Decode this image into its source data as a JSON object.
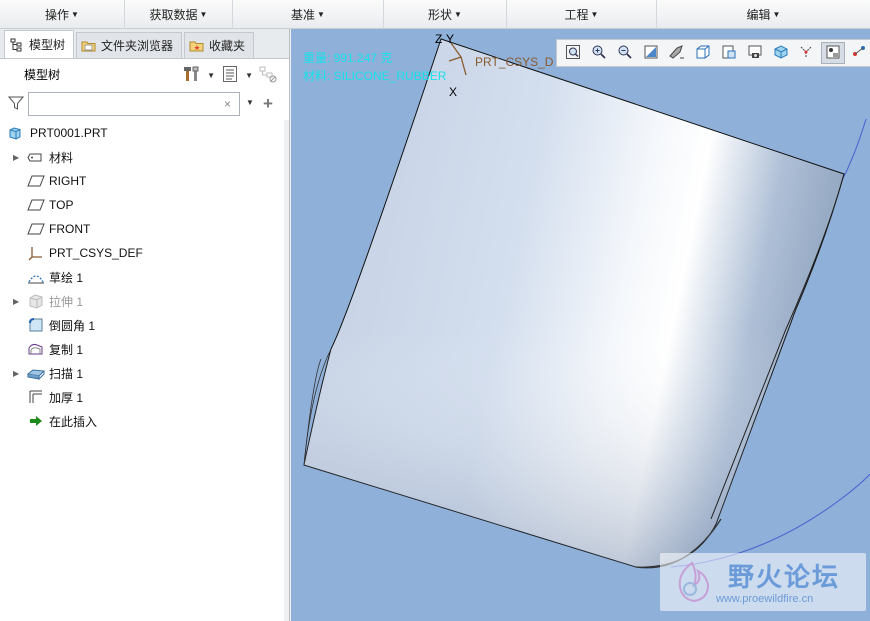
{
  "ribbon": {
    "groups": [
      {
        "label": "操作"
      },
      {
        "label": "获取数据"
      },
      {
        "label": "基准"
      },
      {
        "label": "形状"
      },
      {
        "label": "工程"
      },
      {
        "label": "编辑"
      }
    ]
  },
  "tabs": [
    {
      "label": "模型树",
      "icon": "model-tree-icon",
      "active": true
    },
    {
      "label": "文件夹浏览器",
      "icon": "folder-browser-icon",
      "active": false
    },
    {
      "label": "收藏夹",
      "icon": "favorites-icon",
      "active": false
    }
  ],
  "tree_header": {
    "title": "模型树"
  },
  "filter": {
    "value": "",
    "placeholder": "",
    "clear": "×",
    "add": "+"
  },
  "tree": {
    "items": [
      {
        "label": "PRT0001.PRT",
        "icon": "part-icon",
        "expandable": false,
        "greyed": false
      },
      {
        "label": "材料",
        "icon": "material-icon",
        "expandable": true,
        "greyed": false
      },
      {
        "label": "RIGHT",
        "icon": "datum-plane-icon",
        "expandable": false,
        "greyed": false
      },
      {
        "label": "TOP",
        "icon": "datum-plane-icon",
        "expandable": false,
        "greyed": false
      },
      {
        "label": "FRONT",
        "icon": "datum-plane-icon",
        "expandable": false,
        "greyed": false
      },
      {
        "label": "PRT_CSYS_DEF",
        "icon": "csys-icon",
        "expandable": false,
        "greyed": false
      },
      {
        "label": "草绘 1",
        "icon": "sketch-icon",
        "expandable": false,
        "greyed": false
      },
      {
        "label": "拉伸 1",
        "icon": "extrude-icon",
        "expandable": true,
        "greyed": true
      },
      {
        "label": "倒圆角 1",
        "icon": "round-icon",
        "expandable": false,
        "greyed": false
      },
      {
        "label": "复制 1",
        "icon": "copy-icon",
        "expandable": false,
        "greyed": false
      },
      {
        "label": "扫描 1",
        "icon": "sweep-icon",
        "expandable": true,
        "greyed": false
      },
      {
        "label": "加厚 1",
        "icon": "thicken-icon",
        "expandable": false,
        "greyed": false
      },
      {
        "label": "在此插入",
        "icon": "insert-here-icon",
        "expandable": false,
        "greyed": false
      }
    ]
  },
  "viewport": {
    "overlay_line1": "重量: 991.247 克",
    "overlay_line2": "材料: SILICONE_RUBBER",
    "csys_label": "PRT_CSYS_D",
    "axis_z": "Z",
    "axis_y": "Y",
    "axis_x": "X",
    "toolbar": [
      "refit-icon",
      "zoom-in-icon",
      "zoom-out-icon",
      "repaint-icon",
      "display-style-icon",
      "saved-views-icon",
      "view-manager-icon",
      "perspective-icon",
      "section-icon",
      "spin-center-icon",
      "annotation-display-icon",
      "datum-display-icon"
    ]
  },
  "watermark": {
    "text": "野火论坛",
    "url": "www.proewildfire.cn"
  },
  "colors": {
    "viewport_bg": "#8fb0d8",
    "overlay_text": "#18e0ea",
    "csys": "#8a5a30"
  }
}
